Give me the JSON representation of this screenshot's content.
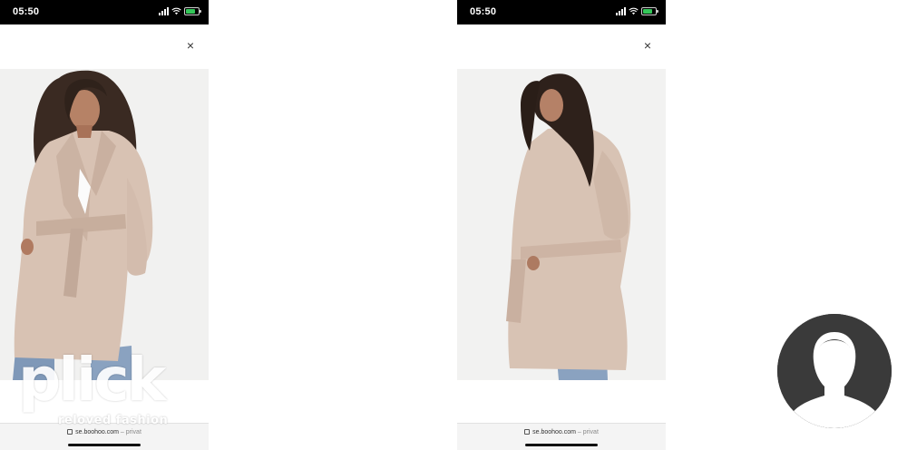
{
  "screens": [
    {
      "status": {
        "time": "05:50"
      },
      "close_label": "×",
      "image_alt": "Model wearing beige belted wrap coat, front view",
      "url": {
        "domain": "se.boohoo.com",
        "suffix": " – privat"
      }
    },
    {
      "status": {
        "time": "05:50"
      },
      "close_label": "×",
      "image_alt": "Model wearing beige belted wrap coat, back view",
      "url": {
        "domain": "se.boohoo.com",
        "suffix": " – privat"
      }
    }
  ],
  "watermark": {
    "word": "plick",
    "tagline": "reloved fashion"
  },
  "icons": [
    "signal-icon",
    "wifi-icon",
    "battery-icon",
    "close-icon",
    "lock-icon",
    "avatar-silhouette-icon"
  ],
  "colors": {
    "status_bar": "#000000",
    "battery": "#34c759",
    "coat": "#d9c3b4",
    "avatar_bg": "#3a3a3a"
  }
}
